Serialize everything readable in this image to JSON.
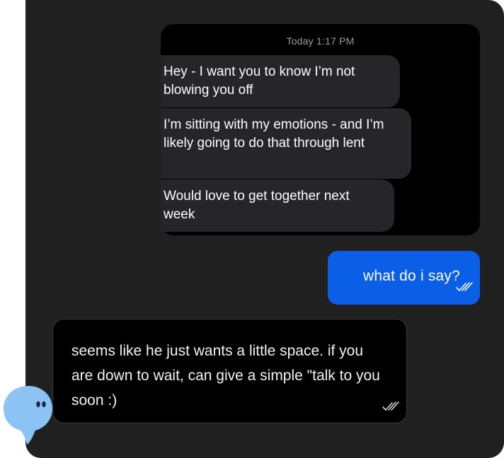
{
  "shared_screenshot": {
    "timestamp": "Today 1:17 PM",
    "messages": [
      "Hey - I want you to know I’m not blowing you off",
      "I’m sitting with my emotions - and I’m likely going to do that through lent",
      "Would love to get together next week"
    ]
  },
  "outgoing_message": {
    "text": "what do i say?",
    "status_icon": "double-check-icon",
    "color": "#0a5fe6"
  },
  "assistant_reply": {
    "text": "seems like he just wants a little space. if you are down to wait, can give a simple \"talk to you soon :)",
    "status_icon": "double-check-icon"
  },
  "avatar": {
    "icon": "blue-blob-avatar",
    "color": "#8cc3f5"
  }
}
